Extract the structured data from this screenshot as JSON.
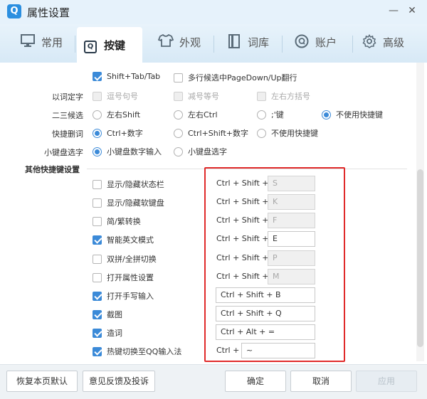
{
  "window": {
    "title": "属性设置",
    "logo_letter": "Q",
    "minimize": "—",
    "close": "✕"
  },
  "tabs": [
    {
      "label": "常用",
      "icon": "monitor-icon",
      "glyph": "🖥"
    },
    {
      "label": "按键",
      "icon": "key-icon",
      "glyph": "Q",
      "active": true
    },
    {
      "label": "外观",
      "icon": "shirt-icon",
      "glyph": "👕"
    },
    {
      "label": "词库",
      "icon": "book-icon",
      "glyph": "▌"
    },
    {
      "label": "账户",
      "icon": "account-icon",
      "glyph": "Q"
    },
    {
      "label": "高级",
      "icon": "gear-icon",
      "glyph": "⚙"
    }
  ],
  "top_options": {
    "shift_tab": "Shift+Tab/Tab",
    "multiline_pagedown": "多行候选中PageDown/Up翻行"
  },
  "word_select": {
    "label": "以词定字",
    "opt1": "逗号句号",
    "opt2": "减号等号",
    "opt3": "左右方括号"
  },
  "second_third": {
    "label": "二三候选",
    "opt1": "左右Shift",
    "opt2": "左右Ctrl",
    "opt3": ";'键",
    "opt4": "不使用快捷键"
  },
  "quick_delete": {
    "label": "快捷删词",
    "opt1": "Ctrl+数字",
    "opt2": "Ctrl+Shift+数字",
    "opt3": "不使用快捷键"
  },
  "numpad_select": {
    "label": "小键盘选字",
    "opt1": "小键盘数字输入",
    "opt2": "小键盘选字"
  },
  "other_hotkeys": {
    "section_title": "其他快捷键设置",
    "items": [
      {
        "label": "显示/隐藏状态栏",
        "checked": false,
        "combo": "Ctrl + Shift +",
        "key": "S",
        "enabled": false
      },
      {
        "label": "显示/隐藏软键盘",
        "checked": false,
        "combo": "Ctrl + Shift +",
        "key": "K",
        "enabled": false
      },
      {
        "label": "简/繁转换",
        "checked": false,
        "combo": "Ctrl + Shift +",
        "key": "F",
        "enabled": false
      },
      {
        "label": "智能英文模式",
        "checked": true,
        "combo": "Ctrl + Shift +",
        "key": "E",
        "enabled": true
      },
      {
        "label": "双拼/全拼切换",
        "checked": false,
        "combo": "Ctrl + Shift +",
        "key": "P",
        "enabled": false
      },
      {
        "label": "打开属性设置",
        "checked": false,
        "combo": "Ctrl + Shift +",
        "key": "M",
        "enabled": false
      },
      {
        "label": "打开手写输入",
        "checked": true,
        "combo": "",
        "key": "Ctrl + Shift + B",
        "enabled": true
      },
      {
        "label": "截图",
        "checked": true,
        "combo": "",
        "key": "Ctrl + Shift + Q",
        "enabled": true
      },
      {
        "label": "造词",
        "checked": true,
        "combo": "",
        "key": "Ctrl + Alt + =",
        "enabled": true
      },
      {
        "label": "热键切换至QQ输入法",
        "checked": true,
        "combo": "Ctrl +",
        "key": "~",
        "enabled": true
      }
    ]
  },
  "footer": {
    "restore_default": "恢复本页默认",
    "feedback": "意见反馈及投诉",
    "ok": "确定",
    "cancel": "取消",
    "apply": "应用"
  },
  "colors": {
    "accent": "#3b8ad8",
    "highlight_box": "#e02a2a"
  }
}
